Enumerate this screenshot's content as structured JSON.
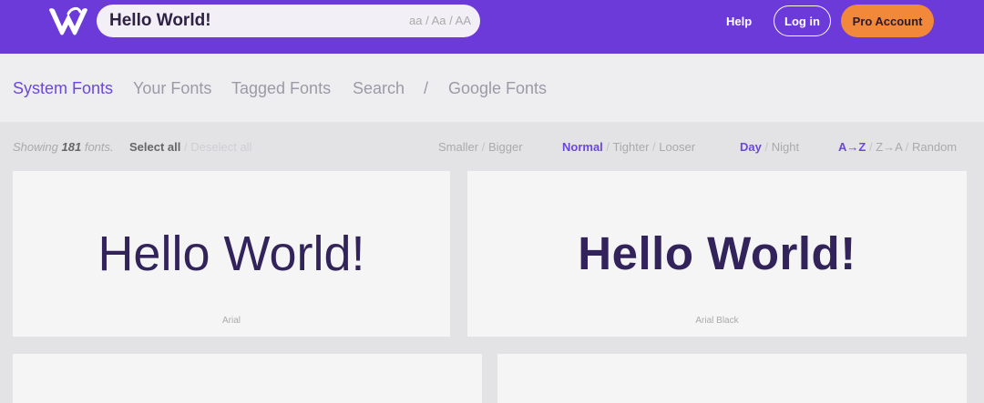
{
  "header": {
    "search_value": "Hello World!",
    "case_options": [
      "aa",
      "Aa",
      "AA"
    ],
    "help_label": "Help",
    "login_label": "Log in",
    "pro_label": "Pro Account"
  },
  "tabs": [
    "System Fonts",
    "Your Fonts",
    "Tagged Fonts",
    "Search",
    "/",
    "Google Fonts"
  ],
  "toolbar": {
    "showing_prefix": "Showing",
    "showing_count": "181",
    "showing_suffix": "fonts.",
    "select_all": "Select all",
    "deselect_all": "Deselect all",
    "size_smaller": "Smaller",
    "size_bigger": "Bigger",
    "spacing_normal": "Normal",
    "spacing_tighter": "Tighter",
    "spacing_looser": "Looser",
    "theme_day": "Day",
    "theme_night": "Night",
    "sort_az": "A→Z",
    "sort_za": "Z→A",
    "sort_random": "Random",
    "sep": "/"
  },
  "cards": [
    {
      "sample": "Hello World!",
      "font_name": "Arial"
    },
    {
      "sample": "Hello World!",
      "font_name": "Arial Black"
    }
  ],
  "colors": {
    "header_bg": "#6c3ad9",
    "accent": "#6b48d8",
    "pro_button": "#f2883a",
    "sample_text": "#32235a"
  }
}
